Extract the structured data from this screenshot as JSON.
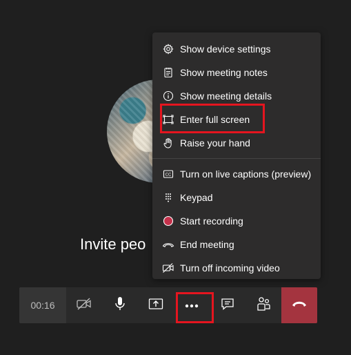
{
  "call": {
    "invite_text": "Invite peo"
  },
  "menu": {
    "items": [
      {
        "label": "Show device settings",
        "icon": "gear-icon"
      },
      {
        "label": "Show meeting notes",
        "icon": "notes-icon"
      },
      {
        "label": "Show meeting details",
        "icon": "info-icon"
      },
      {
        "label": "Enter full screen",
        "icon": "fullscreen-icon"
      },
      {
        "label": "Raise your hand",
        "icon": "hand-icon"
      },
      {
        "label": "Turn on live captions (preview)",
        "icon": "captions-icon"
      },
      {
        "label": "Keypad",
        "icon": "keypad-icon"
      },
      {
        "label": "Start recording",
        "icon": "record-icon"
      },
      {
        "label": "End meeting",
        "icon": "end-meeting-icon"
      },
      {
        "label": "Turn off incoming video",
        "icon": "video-off-icon"
      }
    ]
  },
  "toolbar": {
    "timer": "00:16",
    "buttons": [
      "camera-off-icon",
      "microphone-icon",
      "share-screen-icon",
      "more-options-icon",
      "chat-icon",
      "participants-icon",
      "hang-up-icon"
    ]
  },
  "colors": {
    "background": "#1f1f1f",
    "menu_bg": "#2d2c2c",
    "highlight": "#e5151f",
    "hangup": "#a4343f",
    "record": "#c4314b"
  }
}
